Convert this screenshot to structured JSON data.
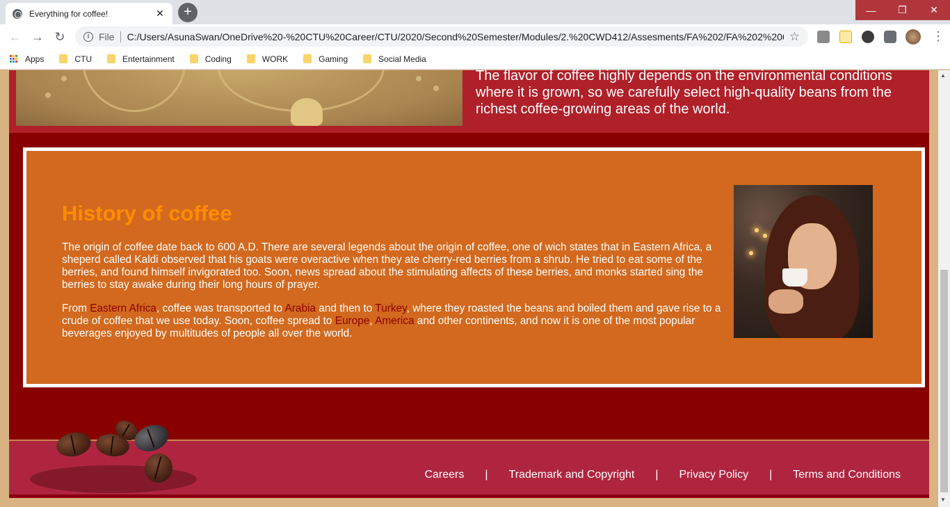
{
  "browser": {
    "tab_title": "Everything for coffee!",
    "tab_close": "✕",
    "new_tab": "+",
    "window_controls": [
      "—",
      "❐",
      "✕"
    ],
    "nav": {
      "back": "←",
      "forward": "→",
      "reload": "↻"
    },
    "url_scheme": "File",
    "url": "C:/Users/AsunaSwan/OneDrive%20-%20CTU%20Career/CTU/2020/Second%20Semester/Modules/2.%20CWD412/Assesments/FA%202/FA%202%2069...",
    "bookmarks": [
      "Apps",
      "CTU",
      "Entertainment",
      "Coding",
      "WORK",
      "Gaming",
      "Social Media"
    ]
  },
  "intro": {
    "text": "The flavor of coffee highly depends on the environmental conditions where it is grown, so we carefully select high-quality beans from the richest coffee-growing areas of the world."
  },
  "history": {
    "title": "History of coffee",
    "paragraph1": "The origin of coffee date back to 600 A.D. There are several legends about the origin of coffee, one of wich states that in Eastern Africa, a sheperd called Kaldi observed that his goats were overactive when they ate cherry-red berries from a shrub. He tried to eat some of the berries, and found himself invigorated too. Soon, news spread about the stimulating affects of these berries, and monks started sing the berries to stay awake during their long hours of prayer.",
    "p2": {
      "t1": "From ",
      "link1": "Eastern Africa",
      "t2": ", coffee was transported to ",
      "link2": "Arabia",
      "t3": " and then to ",
      "link3": "Turkey",
      "t4": ", where they roasted the beans and boiled them and gave rise to a crude of coffee that we use today. Soon, coffee spread to ",
      "link4": "Europe",
      "t5": ", ",
      "link5": "America",
      "t6": " and other continents, and now it is one of the most popular beverages enjoyed by multitudes of people all over the world."
    }
  },
  "footer": {
    "links": [
      "Careers",
      "Trademark and Copyright",
      "Privacy Policy",
      "Terms and Conditions"
    ],
    "separator": "|"
  },
  "colors": {
    "header_red": "#af2029",
    "dark_red": "#880000",
    "history_orange": "#d2691e",
    "title_orange": "#ff8c00",
    "link_red": "#8b0000",
    "footer_pink": "#af2540"
  }
}
